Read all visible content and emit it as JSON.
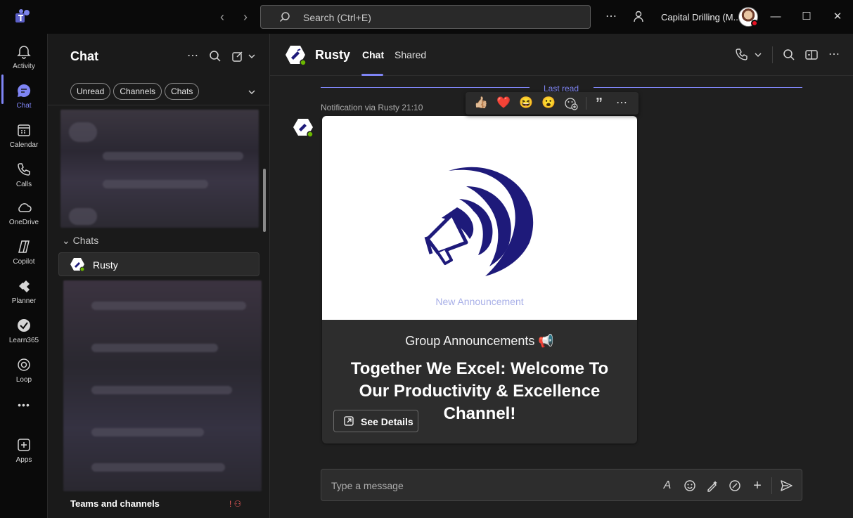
{
  "titlebar": {
    "search_placeholder": "Search (Ctrl+E)",
    "org_name": "Capital Drilling (M...",
    "icons": [
      "teams-logo-icon",
      "back-icon",
      "forward-icon",
      "search-icon",
      "more-icon",
      "people-icon",
      "minimize-icon",
      "maximize-icon",
      "close-icon"
    ]
  },
  "rail": {
    "items": [
      {
        "label": "Activity",
        "icon": "bell-icon"
      },
      {
        "label": "Chat",
        "icon": "chat-icon",
        "active": true
      },
      {
        "label": "Calendar",
        "icon": "calendar-icon"
      },
      {
        "label": "Calls",
        "icon": "phone-icon"
      },
      {
        "label": "OneDrive",
        "icon": "cloud-icon"
      },
      {
        "label": "Copilot",
        "icon": "copilot-icon"
      },
      {
        "label": "Planner",
        "icon": "planner-icon"
      },
      {
        "label": "Learn365",
        "icon": "learn365-icon"
      },
      {
        "label": "Loop",
        "icon": "loop-icon"
      },
      {
        "label": "Apps",
        "icon": "plus-square-icon"
      }
    ],
    "more_label": "•••"
  },
  "chatlist": {
    "title": "Chat",
    "filters": [
      "Unread",
      "Channels",
      "Chats"
    ],
    "section_chats": "Chats",
    "selected_chat": "Rusty",
    "footer_label": "Teams and channels"
  },
  "conversation": {
    "name": "Rusty",
    "tabs": [
      "Chat",
      "Shared"
    ],
    "active_tab": "Chat",
    "last_read_label": "Last read",
    "message_meta": "Notification via Rusty   21:10",
    "reactions": [
      "👍🏼",
      "❤️",
      "😆",
      "😮"
    ],
    "card": {
      "image_caption": "New Announcement",
      "heading": "Group Announcements 📢",
      "title": "Together We Excel: Welcome To Our Productivity & Excellence Channel!",
      "button_label": "See Details"
    },
    "composer_placeholder": "Type a message"
  },
  "colors": {
    "accent": "#7f85f5",
    "background": "#1f1f1f",
    "rail": "#0a0a0a",
    "online": "#6bb700",
    "logo_navy": "#1e1a7a"
  }
}
